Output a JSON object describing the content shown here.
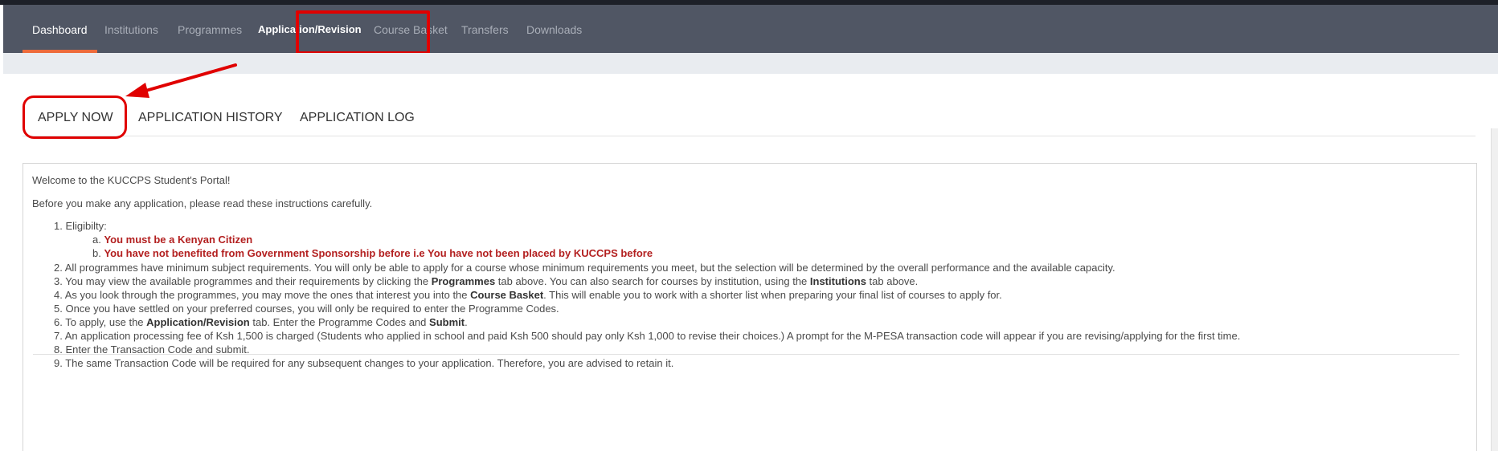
{
  "nav": {
    "items": [
      {
        "label": "Dashboard",
        "active": true
      },
      {
        "label": "Institutions",
        "active": false
      },
      {
        "label": "Programmes",
        "active": false
      },
      {
        "label": "Application/Revision",
        "active": true
      },
      {
        "label": "Course Basket",
        "active": false
      },
      {
        "label": "Transfers",
        "active": false
      },
      {
        "label": "Downloads",
        "active": false
      }
    ]
  },
  "tabs": {
    "items": [
      {
        "label": "APPLY NOW"
      },
      {
        "label": "APPLICATION HISTORY"
      },
      {
        "label": "APPLICATION LOG"
      }
    ]
  },
  "instructions": {
    "welcome": "Welcome to the KUCCPS Student's Portal!",
    "intro": "Before you make any application, please read these instructions carefully.",
    "i1": "1. Eligibilty:",
    "i1a_marker": "a.",
    "i1a": "You must be a Kenyan Citizen",
    "i1b_marker": "b.",
    "i1b": "You have not benefited from Government Sponsorship before i.e You have not been placed by KUCCPS before",
    "i2": "2. All programmes have minimum subject requirements. You will only be able to apply for a course whose minimum requirements you meet, but the selection will be determined by the overall performance and the available capacity.",
    "i3_a": "3. You may view the available programmes and their requirements by clicking the ",
    "i3_b": "Programmes",
    "i3_c": " tab above. You can also search for courses by institution, using the ",
    "i3_d": "Institutions",
    "i3_e": " tab above.",
    "i4_a": "4. As you look through the programmes, you may move the ones that interest you into the ",
    "i4_b": "Course Basket",
    "i4_c": ". This will enable you to work with a shorter list when preparing your final list of courses to apply for.",
    "i5": "5. Once you have settled on your preferred courses, you will only be required to enter the Programme Codes.",
    "i6_a": "6. To apply, use the ",
    "i6_b": "Application/Revision",
    "i6_c": " tab. Enter the Programme Codes and ",
    "i6_d": "Submit",
    "i6_e": ".",
    "i7": "7. An application processing fee of Ksh 1,500 is charged (Students who applied in school and paid Ksh 500 should pay only Ksh 1,000 to revise their choices.) A prompt for the M-PESA transaction code will appear if you are revising/applying for the first time.",
    "i8": "8. Enter the Transaction Code and submit.",
    "i9": "9. The same Transaction Code will be required for any subsequent changes to your application. Therefore, you are advised to retain it."
  },
  "colors": {
    "navbar": "#505664",
    "active_underline": "#ed6b3b",
    "annotation_red": "#e00000",
    "warning_text": "#b32020"
  }
}
